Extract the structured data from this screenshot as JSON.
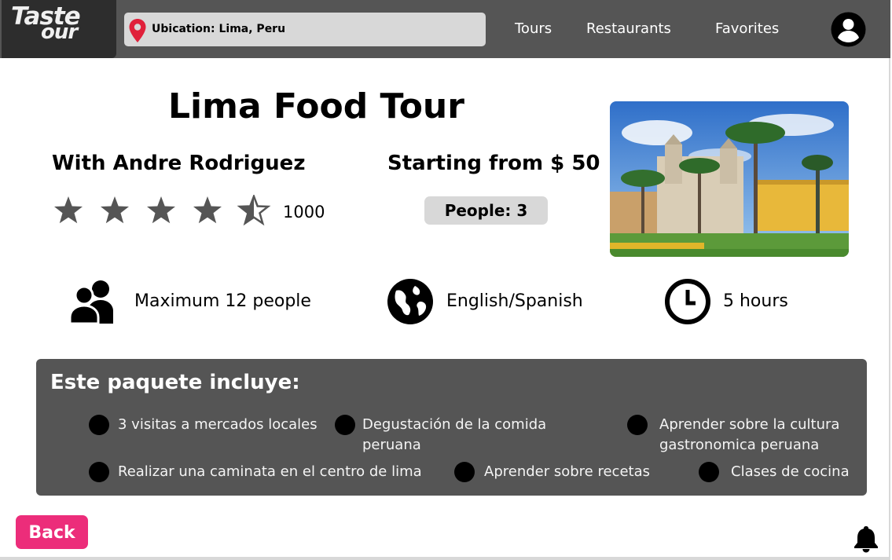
{
  "app": {
    "logo_line1": "Taste",
    "logo_line2": "our"
  },
  "header": {
    "location": "Ubication: Lima, Peru",
    "nav": [
      "Tours",
      "Restaurants",
      "Favorites"
    ]
  },
  "tour": {
    "title": "Lima Food Tour",
    "guide": "With Andre Rodriguez",
    "price": "Starting from $ 50",
    "rating": 4.5,
    "rating_max": 5,
    "reviews": "1000",
    "people": "People: 3"
  },
  "features": {
    "capacity": "Maximum 12 people",
    "languages": "English/Spanish",
    "duration": "5 hours"
  },
  "package": {
    "title": "Este paquete incluye:",
    "items": [
      "3 visitas a mercados locales",
      "Degustación de la comida peruana",
      "Aprender sobre la cultura gastronomica peruana",
      "Realizar una caminata en el centro de lima",
      "Aprender sobre recetas",
      "Clases de cocina"
    ]
  },
  "actions": {
    "back": "Back"
  },
  "icons": {
    "location": "map-pin-icon",
    "account": "user-circle-icon",
    "capacity": "group-icon",
    "languages": "globe-icon",
    "duration": "clock-icon",
    "notifications": "bell-icon"
  },
  "colors": {
    "header_bg": "#555555",
    "accent": "#ec2d7a",
    "pin": "#e0203a",
    "panel_bg": "#555555"
  }
}
